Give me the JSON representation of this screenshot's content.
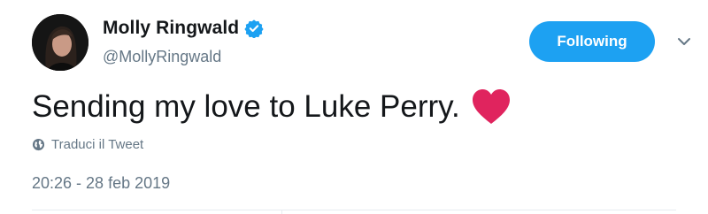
{
  "author": {
    "display_name": "Molly Ringwald",
    "handle": "@MollyRingwald",
    "verified": true,
    "avatar_icon": "profile-photo"
  },
  "follow_button": {
    "label": "Following",
    "color": "#1da1f2"
  },
  "menu": {
    "icon": "chevron-down-icon"
  },
  "tweet": {
    "text": "Sending my love to Luke Perry.",
    "emoji": "red-heart",
    "emoji_color": "#e0245e"
  },
  "translate": {
    "label": "Traduci il Tweet",
    "icon": "globe-icon"
  },
  "timestamp": "20:26 - 28 feb 2019"
}
